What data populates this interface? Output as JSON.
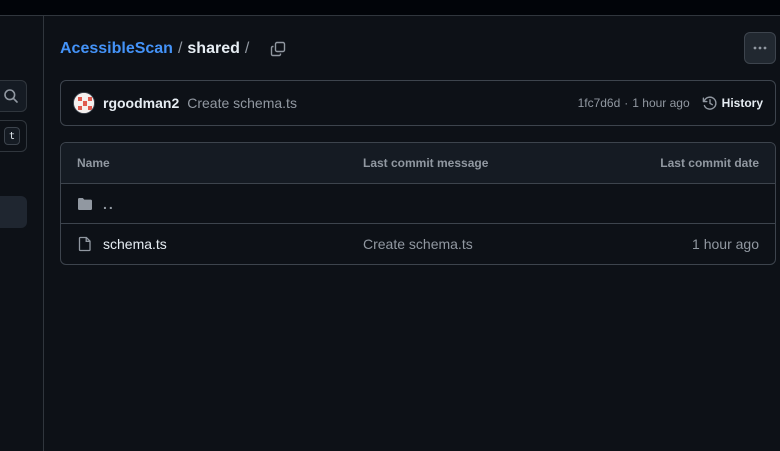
{
  "breadcrumb": {
    "repo": "AcessibleScan",
    "separator": "/",
    "current": "shared",
    "trailing": "/"
  },
  "sidebar": {
    "search_icon": "search-icon",
    "shortcut_key": "t"
  },
  "commit": {
    "author": "rgoodman2",
    "message": "Create schema.ts",
    "hash": "1fc7d6d",
    "separator": "·",
    "time": "1 hour ago",
    "history_label": "History"
  },
  "table": {
    "columns": {
      "name": "Name",
      "message": "Last commit message",
      "date": "Last commit date"
    },
    "parent_dir": "..",
    "rows": [
      {
        "name": "schema.ts",
        "message": "Create schema.ts",
        "date": "1 hour ago",
        "icon": "file-icon"
      }
    ]
  },
  "colors": {
    "background": "#0d1117",
    "link": "#4493f8",
    "border": "#3d444d",
    "muted": "#9198a1"
  }
}
